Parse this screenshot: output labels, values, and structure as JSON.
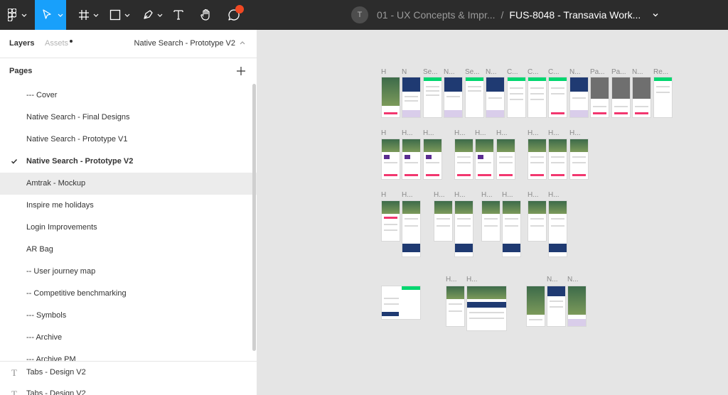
{
  "toolbar": {
    "avatar_initial": "T",
    "project_name": "01 - UX Concepts & Impr...",
    "separator": "/",
    "file_name": "FUS-8048 - Transavia Work...",
    "colors": {
      "background": "#2c2c2c",
      "active_tool": "#18a0fb",
      "notification": "#f24822"
    },
    "tools": [
      "figma-menu-icon",
      "move-tool-icon",
      "frame-tool-icon",
      "shape-tool-icon",
      "pen-tool-icon",
      "text-tool-icon",
      "hand-tool-icon",
      "comment-tool-icon"
    ]
  },
  "panel": {
    "tabs": {
      "layers": "Layers",
      "assets": "Assets"
    },
    "current_page": "Native Search - Prototype V2",
    "pages_title": "Pages",
    "pages": [
      "--- Cover",
      "Native Search - Final Designs",
      "Native Search - Prototype V1",
      "Native Search - Prototype V2",
      "Amtrak - Mockup",
      "Inspire me holidays",
      "Login Improvements",
      "AR Bag",
      "-- User journey map",
      "-- Competitive benchmarking",
      "--- Symbols",
      "--- Archive",
      "--- Archive PM"
    ],
    "layers": [
      "Tabs - Design V2",
      "Tabs - Design V2"
    ]
  },
  "canvas": {
    "row1_labels": [
      "H",
      "N",
      "Se...",
      "N...",
      "Se...",
      "N...",
      "C...",
      "C...",
      "C...",
      "N...",
      "Pa...",
      "Pa...",
      "N...",
      "Re..."
    ],
    "row2_labels": [
      "H",
      "H...",
      "H...",
      "H...",
      "H...",
      "H...",
      "H...",
      "H...",
      "H..."
    ],
    "row3_labels": [
      "H",
      "H...",
      "H...",
      "H...",
      "H...",
      "H...",
      "H...",
      "H..."
    ],
    "row4_labels": [
      "H...",
      "H...",
      "N...",
      "N..."
    ]
  }
}
